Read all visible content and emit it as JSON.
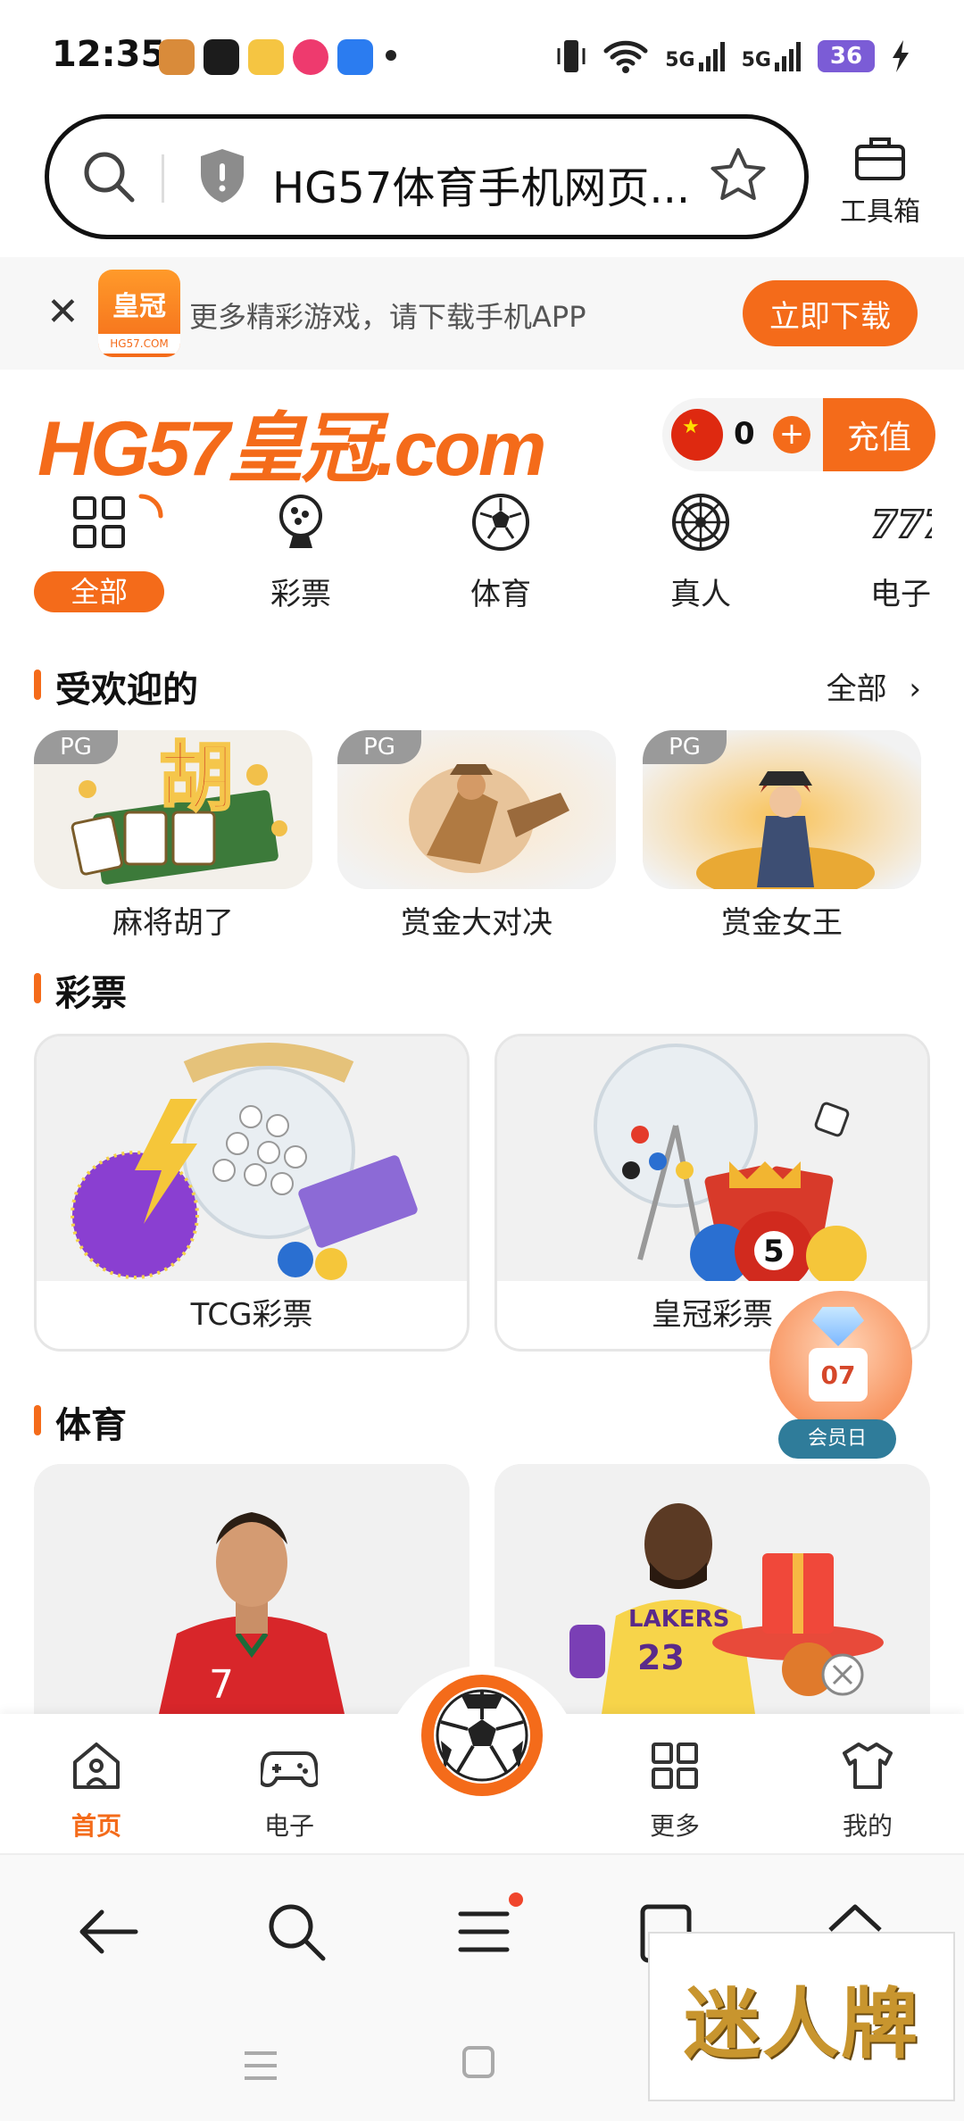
{
  "status_bar": {
    "time": "12:35",
    "signal_1": "5G",
    "signal_2": "5G",
    "battery": "36",
    "app_colors": [
      "#d98b3a",
      "#1c1c1c",
      "#f5c542",
      "#ee3a6e",
      "#2b7cf0"
    ]
  },
  "browser": {
    "url_text": "HG57体育手机网页...",
    "toolbox_label": "工具箱"
  },
  "download_banner": {
    "logo_text": "皇冠",
    "logo_sub": "HG57.COM",
    "message": "更多精彩游戏，请下载手机APP",
    "button": "立即下载"
  },
  "header": {
    "logo": "HG57皇冠.com",
    "balance": "0",
    "recharge": "充值"
  },
  "categories": [
    {
      "label": "全部",
      "icon": "grid-icon",
      "active": true
    },
    {
      "label": "彩票",
      "icon": "lottery-machine-icon"
    },
    {
      "label": "体育",
      "icon": "soccer-ball-icon"
    },
    {
      "label": "真人",
      "icon": "roulette-icon"
    },
    {
      "label": "电子",
      "icon": "slot-777-icon"
    }
  ],
  "popular": {
    "title": "受欢迎的",
    "more": "全部",
    "games": [
      {
        "tag": "PG",
        "name": "麻将胡了"
      },
      {
        "tag": "PG",
        "name": "赏金大对决"
      },
      {
        "tag": "PG",
        "name": "赏金女王"
      }
    ]
  },
  "lottery": {
    "title": "彩票",
    "cards": [
      {
        "name": "TCG彩票"
      },
      {
        "name": "皇冠彩票"
      }
    ]
  },
  "member_day": {
    "date": "07",
    "label": "会员日"
  },
  "sports": {
    "title": "体育"
  },
  "site_nav": [
    {
      "label": "首页",
      "active": true
    },
    {
      "label": "电子"
    },
    {
      "label": "更多"
    },
    {
      "label": "我的"
    }
  ],
  "watermark": "迷人牌",
  "colors": {
    "accent": "#f46b1a",
    "member_badge": "#2f7c9a"
  }
}
